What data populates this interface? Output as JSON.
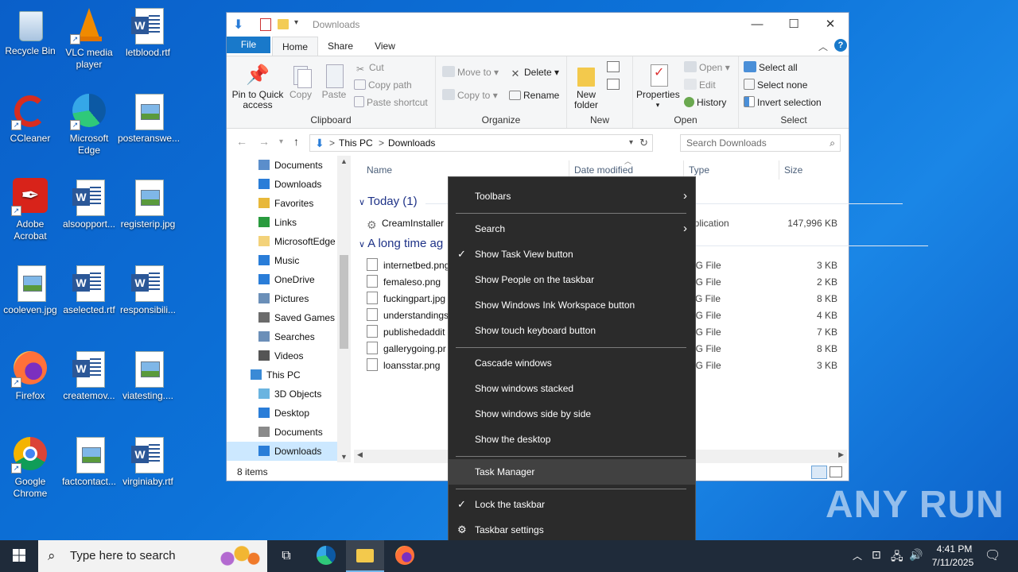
{
  "desktop": {
    "icons": [
      {
        "label": "Recycle Bin",
        "icon": "recycle-bin-icon"
      },
      {
        "label": "VLC media player",
        "icon": "vlc-icon"
      },
      {
        "label": "letblood.rtf",
        "icon": "word-doc-icon"
      },
      {
        "label": "CCleaner",
        "icon": "ccleaner-icon"
      },
      {
        "label": "Microsoft Edge",
        "icon": "edge-icon"
      },
      {
        "label": "posteranswe...",
        "icon": "image-file-icon"
      },
      {
        "label": "Adobe Acrobat",
        "icon": "acrobat-icon"
      },
      {
        "label": "alsoopport...",
        "icon": "word-doc-icon"
      },
      {
        "label": "registerip.jpg",
        "icon": "image-file-icon"
      },
      {
        "label": "cooleven.jpg",
        "icon": "image-file-icon"
      },
      {
        "label": "aselected.rtf",
        "icon": "word-doc-icon"
      },
      {
        "label": "responsibili...",
        "icon": "word-doc-icon"
      },
      {
        "label": "Firefox",
        "icon": "firefox-icon"
      },
      {
        "label": "createmov...",
        "icon": "word-doc-icon"
      },
      {
        "label": "viatesting....",
        "icon": "image-file-icon"
      },
      {
        "label": "Google Chrome",
        "icon": "chrome-icon"
      },
      {
        "label": "factcontact...",
        "icon": "image-file-icon"
      },
      {
        "label": "virginiaby.rtf",
        "icon": "word-doc-icon"
      }
    ]
  },
  "explorer": {
    "title": "Downloads",
    "tabs": {
      "file": "File",
      "home": "Home",
      "share": "Share",
      "view": "View"
    },
    "ribbon": {
      "clipboard": {
        "name": "Clipboard",
        "pin": "Pin to Quick access",
        "copy": "Copy",
        "paste": "Paste",
        "cut": "Cut",
        "copy_path": "Copy path",
        "paste_shortcut": "Paste shortcut"
      },
      "organize": {
        "name": "Organize",
        "move_to": "Move to",
        "copy_to": "Copy to",
        "delete": "Delete",
        "rename": "Rename"
      },
      "new": {
        "name": "New",
        "new_folder": "New folder"
      },
      "open": {
        "name": "Open",
        "properties": "Properties",
        "open": "Open",
        "edit": "Edit",
        "history": "History"
      },
      "select": {
        "name": "Select",
        "select_all": "Select all",
        "select_none": "Select none",
        "invert": "Invert selection"
      }
    },
    "address": {
      "root": "This PC",
      "sep": ">",
      "current": "Downloads"
    },
    "search_placeholder": "Search Downloads",
    "nav": [
      {
        "label": "Documents",
        "color": "#5b8ecb"
      },
      {
        "label": "Downloads",
        "color": "#2a7dd8"
      },
      {
        "label": "Favorites",
        "color": "#e8b83a"
      },
      {
        "label": "Links",
        "color": "#2a9b3e"
      },
      {
        "label": "MicrosoftEdge",
        "color": "#f3d27a"
      },
      {
        "label": "Music",
        "color": "#2a7dd8"
      },
      {
        "label": "OneDrive",
        "color": "#2a7dd8"
      },
      {
        "label": "Pictures",
        "color": "#6b8fb8"
      },
      {
        "label": "Saved Games",
        "color": "#6b6b6b"
      },
      {
        "label": "Searches",
        "color": "#6b8fb8"
      },
      {
        "label": "Videos",
        "color": "#555555"
      },
      {
        "label": "This PC",
        "color": "#3a8ad6"
      },
      {
        "label": "3D Objects",
        "color": "#6ab4e0"
      },
      {
        "label": "Desktop",
        "color": "#2a7dd8"
      },
      {
        "label": "Documents",
        "color": "#8a8a8a"
      },
      {
        "label": "Downloads",
        "color": "#2a7dd8"
      }
    ],
    "columns": {
      "name": "Name",
      "date": "Date modified",
      "type": "Type",
      "size": "Size"
    },
    "groups": {
      "today": "Today (1)",
      "older": "A long time ag"
    },
    "files_today": [
      {
        "name": "CreamInstaller",
        "type": "pplication",
        "size": "147,996 KB"
      }
    ],
    "files_older": [
      {
        "name": "internetbed.png",
        "type": "NG File",
        "size": "3 KB"
      },
      {
        "name": "femaleso.png",
        "type": "NG File",
        "size": "2 KB"
      },
      {
        "name": "fuckingpart.jpg",
        "type": "PG File",
        "size": "8 KB"
      },
      {
        "name": "understandings",
        "type": "NG File",
        "size": "4 KB"
      },
      {
        "name": "publishedaddit",
        "type": "NG File",
        "size": "7 KB"
      },
      {
        "name": "gallerygoing.pr",
        "type": "NG File",
        "size": "8 KB"
      },
      {
        "name": "loansstar.png",
        "type": "NG File",
        "size": "3 KB"
      }
    ],
    "status": "8 items"
  },
  "context_menu": {
    "toolbars": "Toolbars",
    "search": "Search",
    "task_view": "Show Task View button",
    "people": "Show People on the taskbar",
    "ink": "Show Windows Ink Workspace button",
    "touch_kb": "Show touch keyboard button",
    "cascade": "Cascade windows",
    "stacked": "Show windows stacked",
    "side_by_side": "Show windows side by side",
    "show_desktop": "Show the desktop",
    "task_manager": "Task Manager",
    "lock": "Lock the taskbar",
    "settings": "Taskbar settings"
  },
  "taskbar": {
    "search_placeholder": "Type here to search",
    "time": "4:41 PM",
    "date": "7/11/2025"
  },
  "watermark": "ANY RUN"
}
